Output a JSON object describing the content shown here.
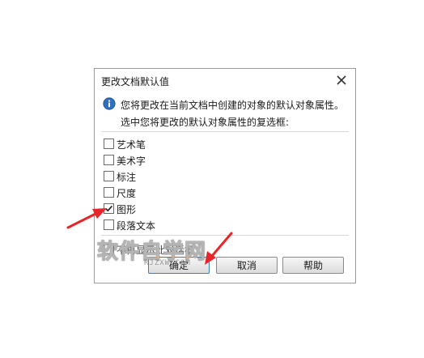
{
  "dialog": {
    "title": "更改文档默认值",
    "info_line1": "您将更改在当前文档中创建的对象的默认对象属性。",
    "info_line2": "选中您将更改的默认对象属性的复选框:",
    "checkboxes": [
      {
        "label": "艺术笔",
        "checked": false
      },
      {
        "label": "美术字",
        "checked": false
      },
      {
        "label": "标注",
        "checked": false
      },
      {
        "label": "尺度",
        "checked": false
      },
      {
        "label": "图形",
        "checked": true
      },
      {
        "label": "段落文本",
        "checked": false
      }
    ],
    "bottom_check_label": "不再显示此对话框",
    "buttons": {
      "ok": "确定",
      "cancel": "取消",
      "help": "帮助"
    }
  },
  "watermark": {
    "main": "软件自学网",
    "sub": "RJZXW.COM"
  },
  "colors": {
    "arrow": "#e8262a",
    "info_icon": "#2f6fbf",
    "check_mark": "#1a1a1a"
  },
  "icons": {
    "close": "close-icon",
    "info": "info-icon",
    "check": "check-mark-icon",
    "annotation": "red-arrow-annotation"
  }
}
